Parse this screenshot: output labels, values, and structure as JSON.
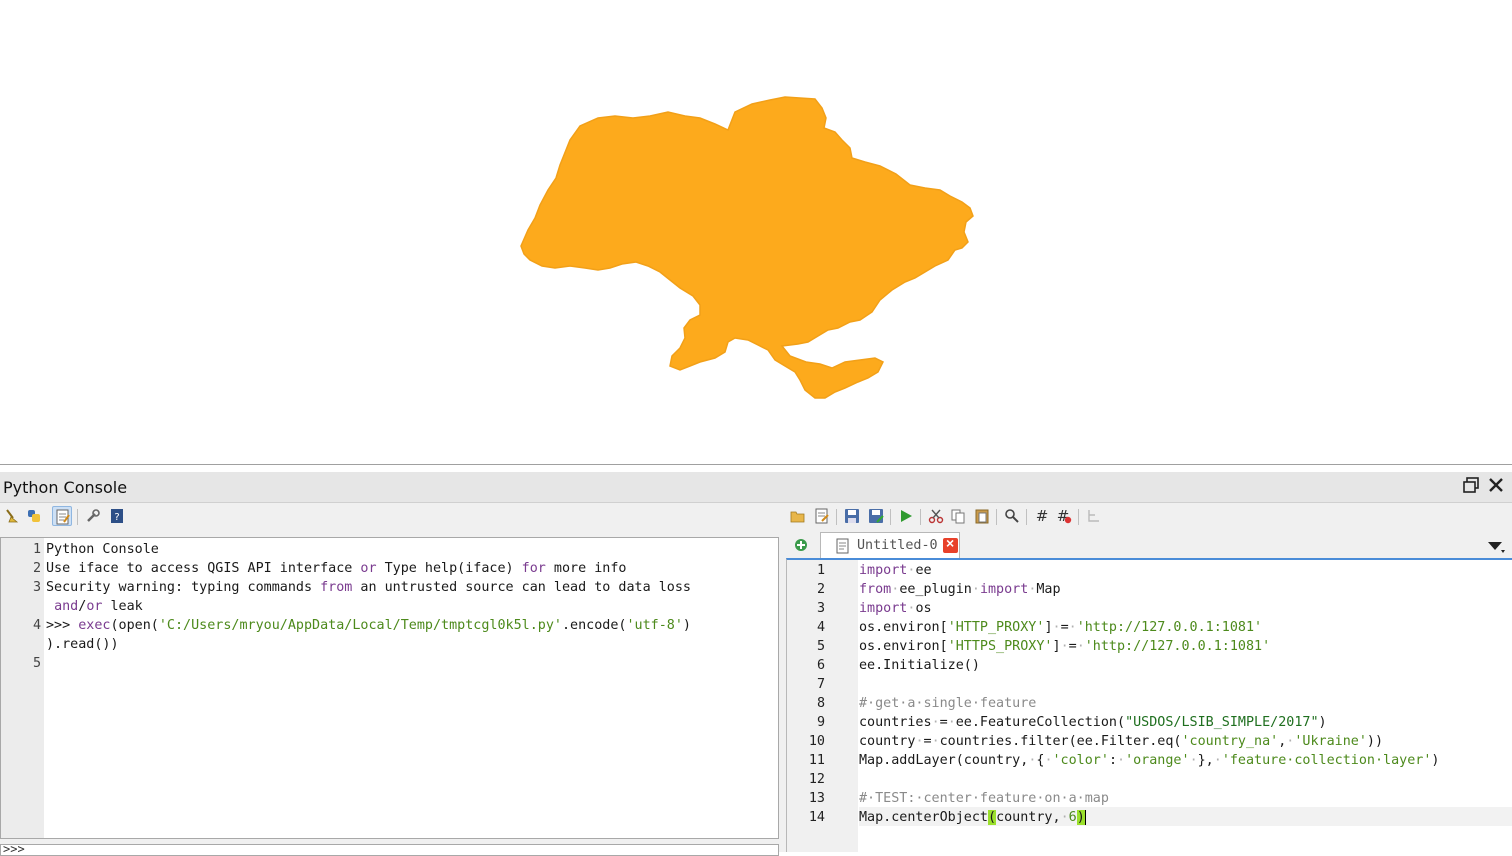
{
  "map": {
    "fill_color": "#fdaa1c",
    "stroke_color": "#f2a018"
  },
  "console": {
    "title": "Python Console",
    "title_buttons": [
      "float-icon",
      "close-icon"
    ],
    "toolbar_icons": [
      "clear-console-icon",
      "import-class-icon",
      "show-editor-icon",
      "settings-icon",
      "help-icon"
    ],
    "output_lines": [
      {
        "n": "1",
        "parts": [
          {
            "t": "Python Console",
            "c": ""
          }
        ]
      },
      {
        "n": "2",
        "parts": [
          {
            "t": "Use iface to access QGIS API interface ",
            "c": ""
          },
          {
            "t": "or",
            "c": "kw"
          },
          {
            "t": " Type help(iface) ",
            "c": ""
          },
          {
            "t": "for",
            "c": "kw"
          },
          {
            "t": " more info",
            "c": ""
          }
        ]
      },
      {
        "n": "3",
        "parts": [
          {
            "t": "Security warning: typing commands ",
            "c": ""
          },
          {
            "t": "from",
            "c": "kw"
          },
          {
            "t": " an untrusted source can lead to data loss",
            "c": ""
          }
        ]
      },
      {
        "n": "",
        "parts": [
          {
            "t": " ",
            "c": ""
          },
          {
            "t": "and",
            "c": "kw"
          },
          {
            "t": "/",
            "c": ""
          },
          {
            "t": "or",
            "c": "kw"
          },
          {
            "t": " leak",
            "c": ""
          }
        ]
      },
      {
        "n": "4",
        "parts": [
          {
            "t": ">>> ",
            "c": ""
          },
          {
            "t": "exec",
            "c": "fn"
          },
          {
            "t": "(open(",
            "c": ""
          },
          {
            "t": "'C:/Users/mryou/AppData/Local/Temp/tmptcgl0k5l.py'",
            "c": "str"
          },
          {
            "t": ".encode(",
            "c": ""
          },
          {
            "t": "'utf-8'",
            "c": "str"
          },
          {
            "t": ")",
            "c": ""
          }
        ]
      },
      {
        "n": "",
        "parts": [
          {
            "t": ").read())",
            "c": ""
          }
        ]
      },
      {
        "n": "5",
        "parts": [
          {
            "t": "",
            "c": ""
          }
        ]
      }
    ],
    "input_prompt": ">>>"
  },
  "editor": {
    "toolbar_icons": [
      "open-file-icon",
      "open-external-icon",
      "save-icon",
      "save-as-icon",
      "run-script-icon",
      "cut-icon",
      "copy-icon",
      "paste-icon",
      "find-icon",
      "comment-icon",
      "uncomment-icon",
      "object-inspector-icon"
    ],
    "tab_label": "Untitled-0",
    "lines": [
      {
        "n": "1",
        "parts": [
          {
            "t": "import",
            "c": "kw"
          },
          {
            "t": "·",
            "c": "ws"
          },
          {
            "t": "ee",
            "c": ""
          }
        ]
      },
      {
        "n": "2",
        "parts": [
          {
            "t": "from",
            "c": "kw"
          },
          {
            "t": "·",
            "c": "ws"
          },
          {
            "t": "ee_plugin",
            "c": ""
          },
          {
            "t": "·",
            "c": "ws"
          },
          {
            "t": "import",
            "c": "kw"
          },
          {
            "t": "·",
            "c": "ws"
          },
          {
            "t": "Map",
            "c": ""
          }
        ]
      },
      {
        "n": "3",
        "parts": [
          {
            "t": "import",
            "c": "kw"
          },
          {
            "t": "·",
            "c": "ws"
          },
          {
            "t": "os",
            "c": ""
          }
        ]
      },
      {
        "n": "4",
        "parts": [
          {
            "t": "os.environ[",
            "c": ""
          },
          {
            "t": "'HTTP_PROXY'",
            "c": "sstr"
          },
          {
            "t": "]",
            "c": ""
          },
          {
            "t": "·",
            "c": "ws"
          },
          {
            "t": "=",
            "c": ""
          },
          {
            "t": "·",
            "c": "ws"
          },
          {
            "t": "'http://127.0.0.1:1081'",
            "c": "sstr"
          }
        ]
      },
      {
        "n": "5",
        "parts": [
          {
            "t": "os.environ[",
            "c": ""
          },
          {
            "t": "'HTTPS_PROXY'",
            "c": "sstr"
          },
          {
            "t": "]",
            "c": ""
          },
          {
            "t": "·",
            "c": "ws"
          },
          {
            "t": "=",
            "c": ""
          },
          {
            "t": "·",
            "c": "ws"
          },
          {
            "t": "'http://127.0.0.1:1081'",
            "c": "sstr"
          }
        ]
      },
      {
        "n": "6",
        "parts": [
          {
            "t": "ee.Initialize()",
            "c": ""
          }
        ]
      },
      {
        "n": "7",
        "parts": [
          {
            "t": "",
            "c": ""
          }
        ]
      },
      {
        "n": "8",
        "parts": [
          {
            "t": "#·get·a·single·feature",
            "c": "cm"
          }
        ]
      },
      {
        "n": "9",
        "parts": [
          {
            "t": "countries",
            "c": ""
          },
          {
            "t": "·",
            "c": "ws"
          },
          {
            "t": "=",
            "c": ""
          },
          {
            "t": "·",
            "c": "ws"
          },
          {
            "t": "ee.FeatureCollection(",
            "c": ""
          },
          {
            "t": "\"USDOS/LSIB_SIMPLE/2017\"",
            "c": "dstr"
          },
          {
            "t": ")",
            "c": ""
          }
        ]
      },
      {
        "n": "10",
        "parts": [
          {
            "t": "country",
            "c": ""
          },
          {
            "t": "·",
            "c": "ws"
          },
          {
            "t": "=",
            "c": ""
          },
          {
            "t": "·",
            "c": "ws"
          },
          {
            "t": "countries.filter(ee.Filter.eq(",
            "c": ""
          },
          {
            "t": "'country_na'",
            "c": "sstr"
          },
          {
            "t": ",",
            "c": ""
          },
          {
            "t": "·",
            "c": "ws"
          },
          {
            "t": "'Ukraine'",
            "c": "sstr"
          },
          {
            "t": "))",
            "c": ""
          }
        ]
      },
      {
        "n": "11",
        "parts": [
          {
            "t": "Map.addLayer(country,",
            "c": ""
          },
          {
            "t": "·",
            "c": "ws"
          },
          {
            "t": "{",
            "c": ""
          },
          {
            "t": "·",
            "c": "ws"
          },
          {
            "t": "'color'",
            "c": "sstr"
          },
          {
            "t": ":",
            "c": ""
          },
          {
            "t": "·",
            "c": "ws"
          },
          {
            "t": "'orange'",
            "c": "sstr"
          },
          {
            "t": "·",
            "c": "ws"
          },
          {
            "t": "},",
            "c": ""
          },
          {
            "t": "·",
            "c": "ws"
          },
          {
            "t": "'feature·collection·layer'",
            "c": "sstr"
          },
          {
            "t": ")",
            "c": ""
          }
        ]
      },
      {
        "n": "12",
        "parts": [
          {
            "t": "",
            "c": ""
          }
        ]
      },
      {
        "n": "13",
        "parts": [
          {
            "t": "#·TEST:·center·feature·on·a·map",
            "c": "cm"
          }
        ]
      },
      {
        "n": "14",
        "parts": [
          {
            "t": "Map.centerObject",
            "c": ""
          },
          {
            "t": "(",
            "c": "brace"
          },
          {
            "t": "country,",
            "c": ""
          },
          {
            "t": "·",
            "c": "ws"
          },
          {
            "t": "6",
            "c": "num"
          },
          {
            "t": ")",
            "c": "brace"
          }
        ]
      }
    ]
  }
}
